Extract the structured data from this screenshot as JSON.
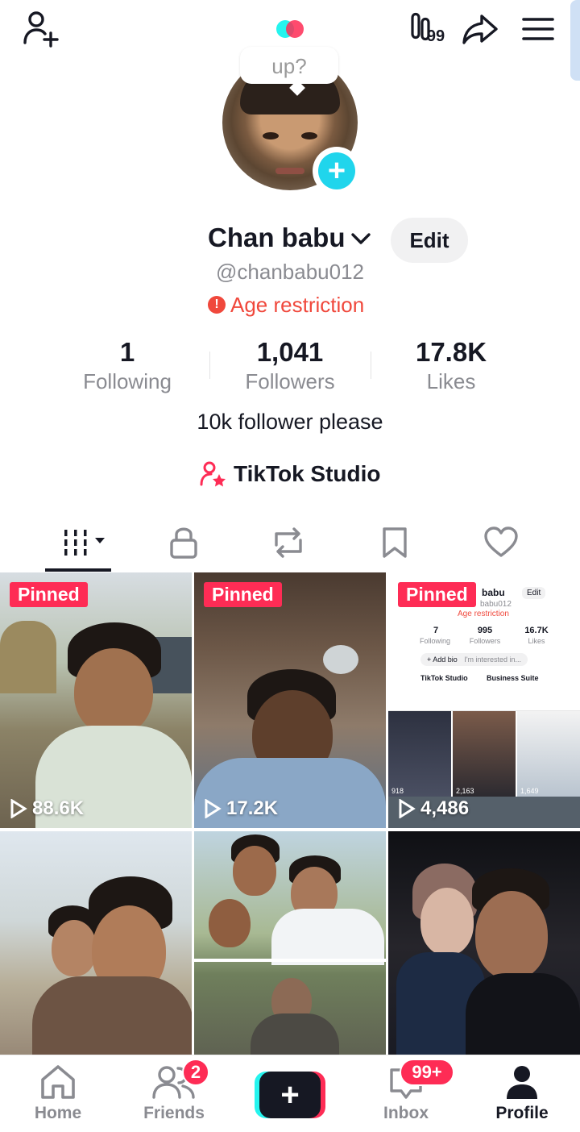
{
  "top_bar": {
    "add_friend_icon": "person-plus-icon",
    "logo_icon": "tiktok-dots-icon",
    "footprint_badge": "99",
    "share_icon": "share-arrow-icon",
    "menu_icon": "hamburger-menu-icon"
  },
  "profile": {
    "bubble_text": "up?",
    "name": "Chan babu",
    "edit_label": "Edit",
    "username": "@chanbabu012",
    "age_restriction": "Age restriction",
    "bio": "10k follower please",
    "studio_label": "TikTok Studio"
  },
  "stats": [
    {
      "value": "1",
      "label": "Following"
    },
    {
      "value": "1,041",
      "label": "Followers"
    },
    {
      "value": "17.8K",
      "label": "Likes"
    }
  ],
  "tabs": [
    "videos-tab",
    "private-tab",
    "reposts-tab",
    "saved-tab",
    "liked-tab"
  ],
  "videos": [
    {
      "pinned": "Pinned",
      "views": "88.6K"
    },
    {
      "pinned": "Pinned",
      "views": "17.2K"
    },
    {
      "pinned": "Pinned",
      "views": "4,486"
    },
    {
      "pinned": "",
      "views": ""
    },
    {
      "pinned": "",
      "views": ""
    },
    {
      "pinned": "",
      "views": ""
    }
  ],
  "screenshot_thumb": {
    "name": "babu",
    "username": "babu012",
    "edit": "Edit",
    "age": "Age restriction",
    "stats": [
      {
        "value": "7",
        "label": "Following"
      },
      {
        "value": "995",
        "label": "Followers"
      },
      {
        "value": "16.7K",
        "label": "Likes"
      }
    ],
    "add_bio": "+ Add bio",
    "interested": "I'm interested in...",
    "studio": "TikTok Studio",
    "business": "Business Suite",
    "mini_views": [
      "918",
      "2,163",
      "1,649"
    ]
  },
  "bottom_nav": {
    "home": "Home",
    "friends": "Friends",
    "friends_badge": "2",
    "inbox": "Inbox",
    "inbox_badge": "99+",
    "profile": "Profile"
  },
  "colors": {
    "accent_red": "#fe2c55",
    "accent_cyan": "#20d5ec",
    "text_dark": "#161823",
    "text_grey": "#8a8b91",
    "warning_red": "#f0483c"
  }
}
